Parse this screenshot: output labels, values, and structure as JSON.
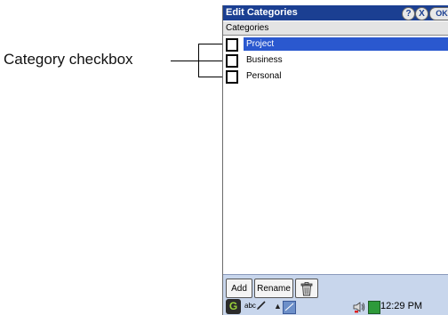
{
  "callout": {
    "text": "Category checkbox"
  },
  "window": {
    "title": "Edit Categories",
    "help_label": "?",
    "close_label": "X",
    "ok_label": "OK"
  },
  "list": {
    "header": "Categories",
    "items": [
      {
        "label": "Project",
        "selected": true,
        "checked": false
      },
      {
        "label": "Business",
        "selected": false,
        "checked": false
      },
      {
        "label": "Personal",
        "selected": false,
        "checked": false
      }
    ]
  },
  "toolbar": {
    "add_label": "Add",
    "rename_label": "Rename",
    "delete_icon": "trash-icon"
  },
  "taskbar": {
    "app_icon_label": "G",
    "input_mode": "abc",
    "clock": "12:29 PM",
    "colors": {
      "bar": "#c8d6ec",
      "title": "#1b3f92",
      "selection": "#2a58cf"
    }
  }
}
